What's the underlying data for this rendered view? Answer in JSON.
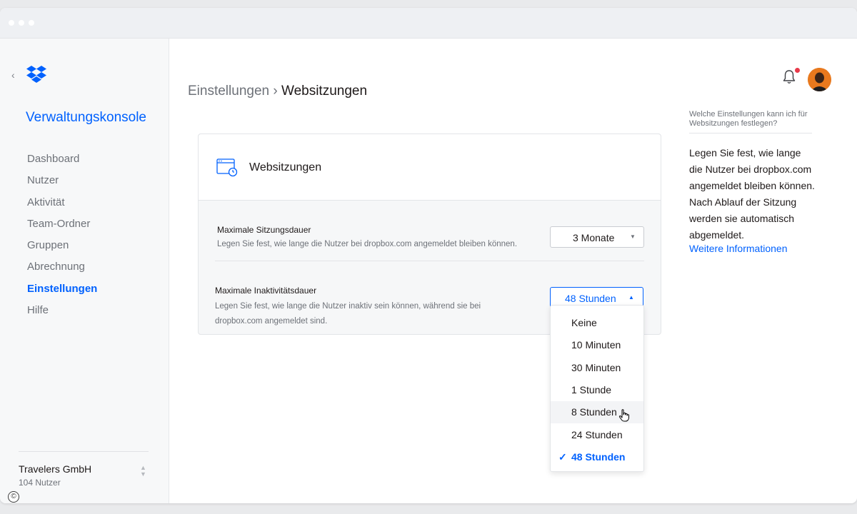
{
  "sidebar": {
    "app_title": "Verwaltungskonsole",
    "items": [
      {
        "label": "Dashboard"
      },
      {
        "label": "Nutzer"
      },
      {
        "label": "Aktivität"
      },
      {
        "label": "Team-Ordner"
      },
      {
        "label": "Gruppen"
      },
      {
        "label": "Abrechnung"
      },
      {
        "label": "Einstellungen"
      },
      {
        "label": "Hilfe"
      }
    ],
    "active_index": 6,
    "org": {
      "name": "Travelers GmbH",
      "users": "104 Nutzer"
    }
  },
  "breadcrumb": {
    "parent": "Einstellungen",
    "separator": "›",
    "current": "Websitzungen"
  },
  "card": {
    "title": "Websitzungen",
    "session": {
      "label": "Maximale Sitzungsdauer",
      "desc": "Legen Sie fest, wie lange die Nutzer bei dropbox.com angemeldet bleiben können.",
      "value": "3 Monate"
    },
    "inactivity": {
      "label": "Maximale Inaktivitätsdauer",
      "desc_line1": "Legen Sie fest, wie lange die Nutzer inaktiv sein können, während sie bei",
      "desc_line2": "dropbox.com angemeldet sind.",
      "value": "48 Stunden"
    }
  },
  "dropdown": {
    "options": [
      "Keine",
      "10 Minuten",
      "30 Minuten",
      "1 Stunde",
      "8 Stunden",
      "24 Stunden",
      "48 Stunden"
    ],
    "selected": "48 Stunden",
    "hovered": "8 Stunden",
    "check_mark": "✓"
  },
  "help": {
    "question": "Welche Einstellungen kann ich für Websitzungen festlegen?",
    "lines": [
      "Legen Sie fest, wie lange",
      "die Nutzer bei dropbox.com",
      "angemeldet bleiben können.",
      "Nach Ablauf der Sitzung",
      "werden sie automatisch",
      "abgemeldet."
    ],
    "link": "Weitere Informationen"
  },
  "colors": {
    "accent": "#0061fe",
    "notification": "#e8394a"
  },
  "icons": [
    "chevron-left-icon",
    "dropbox-logo-icon",
    "bell-icon",
    "browser-clock-icon",
    "caret-down-icon",
    "caret-up-icon",
    "check-icon",
    "hand-pointer-cursor-icon",
    "copyright-icon"
  ]
}
